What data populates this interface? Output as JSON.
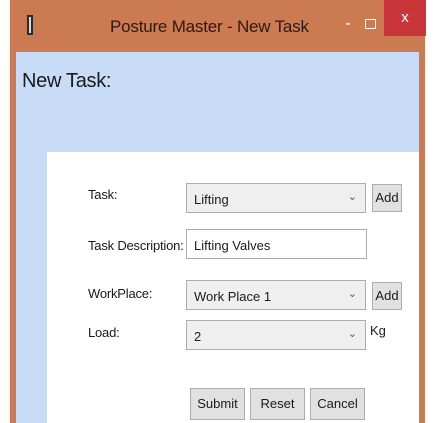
{
  "window": {
    "title": "Posture Master - New Task",
    "minimize_glyph": "-",
    "close_glyph": "x"
  },
  "heading": "New Task:",
  "form": {
    "task": {
      "label": "Task:",
      "value": "Lifting",
      "add_label": "Add"
    },
    "task_description": {
      "label": "Task Description:",
      "value": "Lifting Valves"
    },
    "workplace": {
      "label": "WorkPlace:",
      "value": "Work Place 1",
      "add_label": "Add"
    },
    "load": {
      "label": "Load:",
      "value": "2",
      "unit": "Kg"
    }
  },
  "buttons": {
    "submit": "Submit",
    "reset": "Reset",
    "cancel": "Cancel"
  },
  "icons": {
    "dropdown": "chevron-down-icon",
    "app": "app-icon"
  },
  "colors": {
    "titlebar": "#cc7a52",
    "close": "#c9363a",
    "client": "#c9dcf7"
  }
}
